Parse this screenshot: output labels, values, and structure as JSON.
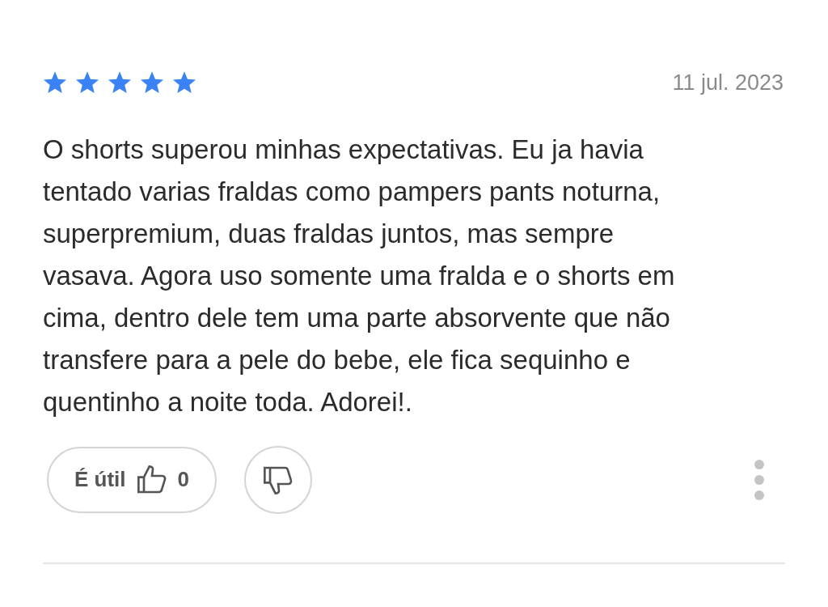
{
  "review": {
    "stars": 5,
    "date": "11 jul. 2023",
    "text": "O shorts superou minhas expectativas. Eu ja havia tentado varias fraldas como pampers pants noturna, superpremium, duas fraldas juntos, mas sempre vasava. Agora uso somente uma fralda e o shorts em cima, dentro dele tem uma parte absorvente que não transfere para a pele do bebe, ele fica sequinho e quentinho a noite toda. Adorei!.",
    "helpful_label": "É útil",
    "helpful_count": "0"
  }
}
